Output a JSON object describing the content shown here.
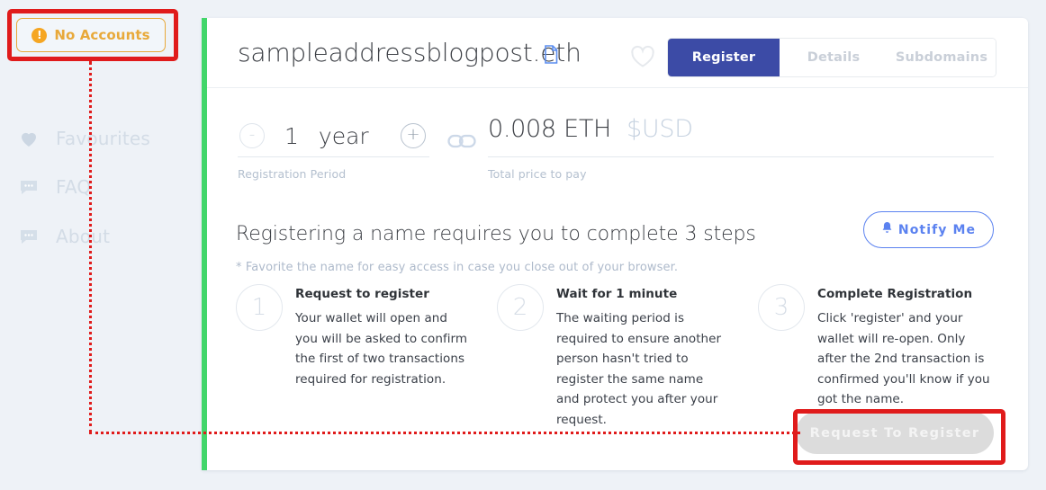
{
  "sidebar": {
    "account_badge": {
      "label": "No Accounts",
      "icon": "alert-circle-icon",
      "color": "#e8a93a"
    },
    "items": [
      {
        "label": "Favourites",
        "icon": "heart-icon"
      },
      {
        "label": "FAQ",
        "icon": "chat-bubble-icon"
      },
      {
        "label": "About",
        "icon": "chat-bubble-icon"
      }
    ]
  },
  "card": {
    "accent_color": "#42d66a",
    "header": {
      "domain_name": "sampleaddressblogpost.eth",
      "copy_icon": "document-copy-icon",
      "favorite_icon": "heart-outline-icon",
      "tabs": [
        {
          "label": "Register",
          "active": true
        },
        {
          "label": "Details",
          "active": false
        },
        {
          "label": "Subdomains",
          "active": false
        }
      ]
    },
    "registration": {
      "period_value": "1",
      "period_unit": "year",
      "period_caption": "Registration Period",
      "decrement_symbol": "-",
      "increment_symbol": "+",
      "link_icon": "chain-link-icon",
      "price_eth": "0.008 ETH",
      "price_usd": "$USD",
      "price_caption": "Total price to pay"
    },
    "steps_section": {
      "heading": "Registering a name requires you to complete 3 steps",
      "note": "* Favorite the name for easy access in case you close out of your browser.",
      "notify_button": {
        "label": "Notify Me",
        "icon": "bell-icon",
        "color": "#5b82f0"
      },
      "steps": [
        {
          "number": "1",
          "title": "Request to register",
          "description": "Your wallet will open and you will be asked to confirm the first of two transactions required for registration."
        },
        {
          "number": "2",
          "title": "Wait for 1 minute",
          "description": "The waiting period is required to ensure another person hasn't tried to register the same name and protect you after your request."
        },
        {
          "number": "3",
          "title": "Complete Registration",
          "description": "Click 'register' and your wallet will re-open. Only after the 2nd transaction is confirmed you'll know if you got the name."
        }
      ]
    },
    "request_button": {
      "label": "Request To Register",
      "disabled": true
    }
  },
  "annotations": {
    "color": "#e01b1b",
    "highlighted": [
      "account-badge",
      "request-to-register-button"
    ]
  }
}
